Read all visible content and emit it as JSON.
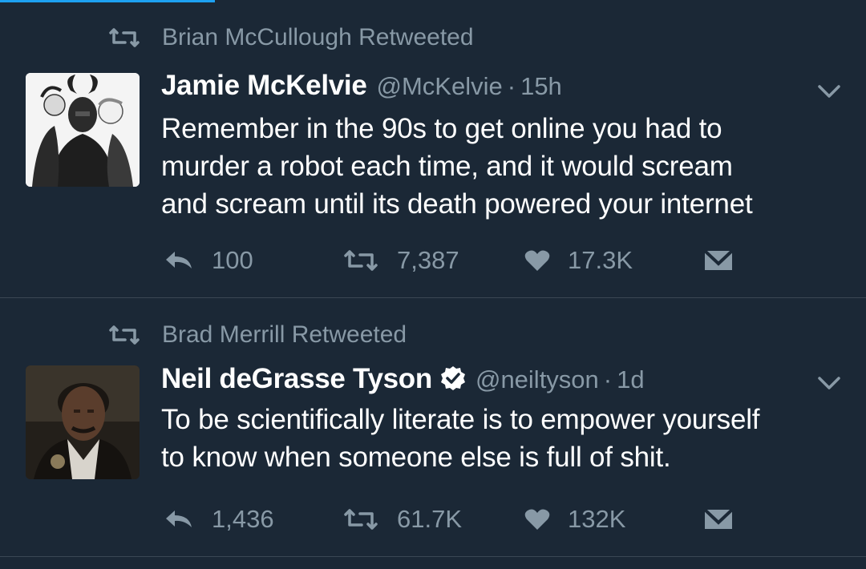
{
  "tweets": [
    {
      "retweeted_by": "Brian McCullough Retweeted",
      "name": "Jamie McKelvie",
      "handle": "@McKelvie",
      "separator": "·",
      "time": "15h",
      "verified": false,
      "lines": [
        "Remember in the 90s to get online you had to",
        "murder a robot each time, and it would scream",
        "and scream until its death powered your internet"
      ],
      "replies": "100",
      "retweets": "7,387",
      "likes": "17.3K"
    },
    {
      "retweeted_by": "Brad Merrill Retweeted",
      "name": "Neil deGrasse Tyson",
      "handle": "@neiltyson",
      "separator": "·",
      "time": "1d",
      "verified": true,
      "lines": [
        "To be scientifically literate is to empower yourself",
        "to know when someone else is full of shit."
      ],
      "replies": "1,436",
      "retweets": "61.7K",
      "likes": "132K"
    }
  ],
  "colors": {
    "background": "#1b2836",
    "muted": "#8899a6",
    "text": "#ffffff",
    "divider": "#3b4754",
    "accent": "#1da1f2"
  },
  "icons": {
    "retweet": "retweet-icon",
    "reply": "reply-icon",
    "like": "heart-icon",
    "dm": "envelope-icon",
    "menu": "chevron-down-icon",
    "verified": "verified-badge-icon"
  }
}
